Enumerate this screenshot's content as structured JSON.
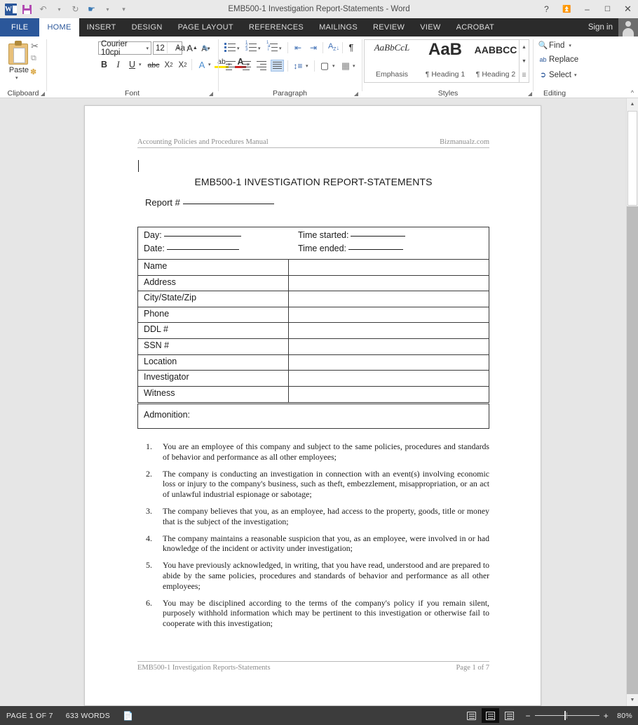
{
  "window": {
    "title": "EMB500-1 Investigation Report-Statements - Word",
    "quick_access": [
      "word-logo",
      "save",
      "undo",
      "redo",
      "touch-mode",
      "customize-qat"
    ],
    "controls": [
      "help",
      "ribbon-display-options",
      "minimize",
      "maximize",
      "close"
    ],
    "help_glyph": "?",
    "ribbon_options_glyph": "⬆",
    "minimize_glyph": "–",
    "maximize_glyph": "❐",
    "close_glyph": "✕",
    "sign_in": "Sign in"
  },
  "tabs": [
    {
      "label": "FILE",
      "active": false,
      "kind": "file"
    },
    {
      "label": "HOME",
      "active": true,
      "kind": "normal"
    },
    {
      "label": "INSERT",
      "active": false,
      "kind": "normal"
    },
    {
      "label": "DESIGN",
      "active": false,
      "kind": "normal"
    },
    {
      "label": "PAGE LAYOUT",
      "active": false,
      "kind": "normal"
    },
    {
      "label": "REFERENCES",
      "active": false,
      "kind": "normal"
    },
    {
      "label": "MAILINGS",
      "active": false,
      "kind": "normal"
    },
    {
      "label": "REVIEW",
      "active": false,
      "kind": "normal"
    },
    {
      "label": "VIEW",
      "active": false,
      "kind": "normal"
    },
    {
      "label": "ACROBAT",
      "active": false,
      "kind": "normal"
    }
  ],
  "ribbon": {
    "clipboard": {
      "group_label": "Clipboard",
      "paste_label": "Paste",
      "cut_glyph": "✂",
      "copy_glyph": "⧉",
      "format_painter_glyph": "🖌"
    },
    "font": {
      "group_label": "Font",
      "font_name": "Courier 10cpi",
      "font_size": "12",
      "grow_font": "A",
      "shrink_font": "A",
      "change_case": "Aa",
      "clear_formatting": "A",
      "bold": "B",
      "italic": "I",
      "underline": "U",
      "strikethrough": "abc",
      "subscript": "X₂",
      "superscript": "X²",
      "text_effects": "A",
      "highlight": "ab",
      "font_color": "A"
    },
    "paragraph": {
      "group_label": "Paragraph",
      "bullets": "bullet-list-icon",
      "numbering": "numbered-list-icon",
      "multilevel": "multilevel-list-icon",
      "decrease_indent": "decrease-indent-icon",
      "increase_indent": "increase-indent-icon",
      "sort": "A↓",
      "show_marks": "¶",
      "align_left": "align-left-icon",
      "align_center": "align-center-icon",
      "align_right": "align-right-icon",
      "justify": "justify-icon",
      "justify_active": true,
      "line_spacing": "line-spacing-icon",
      "shading": "shading-icon",
      "borders": "borders-icon"
    },
    "styles": {
      "group_label": "Styles",
      "items": [
        {
          "preview": "AaBbCcL",
          "name": "Emphasis"
        },
        {
          "preview": "AaB",
          "name": "¶ Heading 1"
        },
        {
          "preview": "AABBCC",
          "name": "¶ Heading 2"
        }
      ]
    },
    "editing": {
      "group_label": "Editing",
      "find": "Find",
      "replace": "Replace",
      "select": "Select",
      "find_icon": "🔍",
      "replace_icon": "ab",
      "select_icon": "↖"
    },
    "collapse_glyph": "⌃"
  },
  "document": {
    "header_left": "Accounting Policies and Procedures Manual",
    "header_right": "Bizmanualz.com",
    "title": "EMB500-1 INVESTIGATION REPORT-STATEMENTS",
    "report_label": "Report #",
    "top_fields": [
      {
        "label": "Day:",
        "blank_width": 110
      },
      {
        "label": "Date:",
        "blank_width": 103
      },
      {
        "label": "Time started:",
        "blank_width": 78
      },
      {
        "label": "Time ended:",
        "blank_width": 78
      }
    ],
    "table_rows": [
      "Name",
      "Address",
      "City/State/Zip",
      "Phone",
      "DDL #",
      "SSN #",
      "Location",
      "Investigator",
      "Witness"
    ],
    "admonition_label": "Admonition:",
    "list_items": [
      {
        "num": "1.",
        "text": "You are an employee of this company and subject to the same policies, procedures and standards of behavior and performance as all other employees;"
      },
      {
        "num": "2.",
        "text": "The company is conducting an investigation in connection with an event(s) involving economic loss or injury to the company's business, such as theft, embezzlement, misappropriation, or an act of unlawful industrial espionage or sabotage;"
      },
      {
        "num": "3.",
        "text": "The company believes that you, as an employee, had access to the property, goods, title or money that is the subject of the investigation;"
      },
      {
        "num": "4.",
        "text": "The company maintains a reasonable suspicion that you, as an employee, were involved in or had knowledge of the incident or activity under investigation;"
      },
      {
        "num": "5.",
        "text": "You have previously acknowledged, in writing, that you have read, understood and are prepared to abide by the same policies, procedures and standards of behavior and performance as all other employees;"
      },
      {
        "num": "6.",
        "text": "You may be disciplined according to the terms of the company's policy if you remain silent, purposely withhold information which may be pertinent to this investigation or otherwise fail to cooperate with this investigation;"
      }
    ],
    "footer_left": "EMB500-1 Investigation Reports-Statements",
    "footer_right": "Page 1 of 7"
  },
  "status_bar": {
    "page": "PAGE 1 OF 7",
    "words": "633 WORDS",
    "proofing_icon": "proofing-errors-icon",
    "views": [
      {
        "name": "read-mode",
        "active": false
      },
      {
        "name": "print-layout",
        "active": true
      },
      {
        "name": "web-layout",
        "active": false
      }
    ],
    "zoom_out": "−",
    "zoom_in": "+",
    "zoom_value": "80%"
  },
  "colors": {
    "accent": "#2b579a",
    "ribbon_tabs_bg": "#2b2b2b",
    "status_bg": "#3c3c3c",
    "workspace": "#e6e6e6"
  }
}
